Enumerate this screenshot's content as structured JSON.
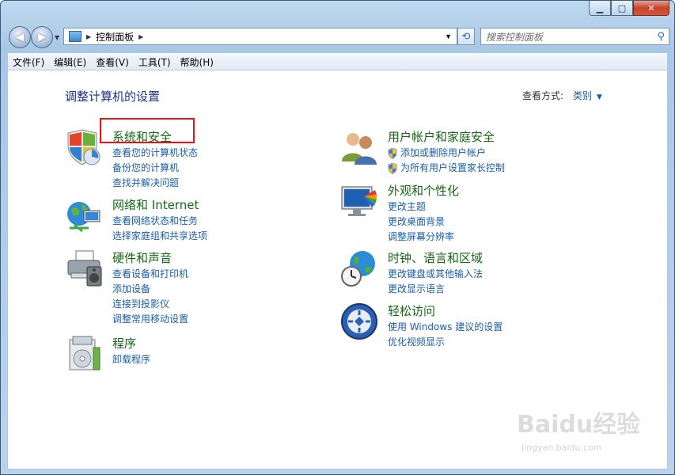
{
  "window": {
    "caption_buttons": {
      "minimize": "▁",
      "maximize": "□",
      "close": "✕"
    }
  },
  "nav": {
    "back": "◀",
    "forward": "▶",
    "address": "控制面板",
    "search_placeholder": "搜索控制面板"
  },
  "menu": [
    "文件(F)",
    "编辑(E)",
    "查看(V)",
    "工具(T)",
    "帮助(H)"
  ],
  "page": {
    "heading": "调整计算机的设置",
    "view_by_label": "查看方式:",
    "view_by_value": "类别"
  },
  "categories": [
    {
      "title": "系统和安全",
      "icon": "system-security-icon",
      "links": [
        "查看您的计算机状态",
        "备份您的计算机",
        "查找并解决问题"
      ]
    },
    {
      "title": "网络和 Internet",
      "icon": "network-internet-icon",
      "links": [
        "查看网络状态和任务",
        "选择家庭组和共享选项"
      ]
    },
    {
      "title": "硬件和声音",
      "icon": "hardware-sound-icon",
      "links": [
        "查看设备和打印机",
        "添加设备",
        "连接到投影仪",
        "调整常用移动设置"
      ]
    },
    {
      "title": "程序",
      "icon": "programs-icon",
      "links": [
        "卸载程序"
      ]
    },
    {
      "title": "用户帐户和家庭安全",
      "icon": "user-accounts-icon",
      "links": [
        "添加或删除用户帐户",
        "为所有用户设置家长控制"
      ]
    },
    {
      "title": "外观和个性化",
      "icon": "appearance-icon",
      "links": [
        "更改主题",
        "更改桌面背景",
        "调整屏幕分辨率"
      ]
    },
    {
      "title": "时钟、语言和区域",
      "icon": "clock-language-icon",
      "links": [
        "更改键盘或其他输入法",
        "更改显示语言"
      ]
    },
    {
      "title": "轻松访问",
      "icon": "ease-of-access-icon",
      "links": [
        "使用 Windows 建议的设置",
        "优化视频显示"
      ]
    }
  ],
  "watermark": {
    "logo": "Baidu经验",
    "url": "jingyan.baidu.com"
  },
  "colors": {
    "heading": "#1e3287",
    "category_title": "#136813",
    "link": "#1a5ea8",
    "highlight": "#e8121a"
  }
}
